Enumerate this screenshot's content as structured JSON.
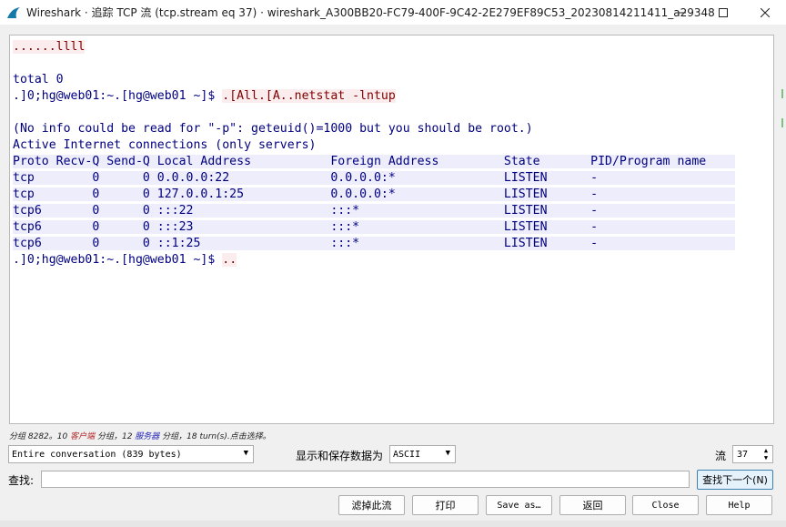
{
  "window": {
    "title": "Wireshark · 追踪 TCP 流 (tcp.stream eq 37) · wireshark_A300BB20-FC79-400F-9C42-2E279EF89C53_20230814211411_a29348"
  },
  "stream": {
    "lines": [
      {
        "kind": "client",
        "text": "......llll"
      },
      {
        "kind": "blank",
        "text": ""
      },
      {
        "kind": "server",
        "text": "total 0"
      },
      {
        "kind": "mixed",
        "prefix": ".]0;hg@web01:~.[hg@web01 ~]$ ",
        "client": ".[All.[A..netstat -lntup"
      },
      {
        "kind": "blank",
        "text": ""
      },
      {
        "kind": "server",
        "text": "(No info could be read for \"-p\": geteuid()=1000 but you should be root.)"
      },
      {
        "kind": "server",
        "text": "Active Internet connections (only servers)"
      },
      {
        "kind": "server-hl",
        "text": "Proto Recv-Q Send-Q Local Address           Foreign Address         State       PID/Program name    "
      },
      {
        "kind": "server-hl",
        "text": "tcp        0      0 0.0.0.0:22              0.0.0.0:*               LISTEN      -                   "
      },
      {
        "kind": "server-hl",
        "text": "tcp        0      0 127.0.0.1:25            0.0.0.0:*               LISTEN      -                   "
      },
      {
        "kind": "server-hl",
        "text": "tcp6       0      0 :::22                   :::*                    LISTEN      -                   "
      },
      {
        "kind": "server-hl",
        "text": "tcp6       0      0 :::23                   :::*                    LISTEN      -                   "
      },
      {
        "kind": "server-hl",
        "text": "tcp6       0      0 ::1:25                  :::*                    LISTEN      -                   "
      },
      {
        "kind": "mixed",
        "prefix": ".]0;hg@web01:~.[hg@web01 ~]$ ",
        "client": ".."
      }
    ]
  },
  "status": {
    "part1": "分组 8282。10 ",
    "client_word": "客户端",
    "part2": " 分组，12 ",
    "server_word": "服务器",
    "part3": " 分组，18 turn(s).点击选择。"
  },
  "controls": {
    "conversation_select": "Entire conversation (839 bytes)",
    "format_label": "显示和保存数据为",
    "format_select": "ASCII",
    "stream_label": "流",
    "stream_value": "37",
    "find_label": "查找:",
    "find_value": "",
    "find_next": "查找下一个(N)"
  },
  "buttons": {
    "filter_out": "滤掉此流",
    "print": "打印",
    "save_as": "Save as…",
    "back": "返回",
    "close": "Close",
    "help": "Help"
  },
  "colors": {
    "client_text": "#7f0000",
    "client_bg": "#fbeded",
    "server_text": "#00007f",
    "server_bg": "#ededfb"
  }
}
